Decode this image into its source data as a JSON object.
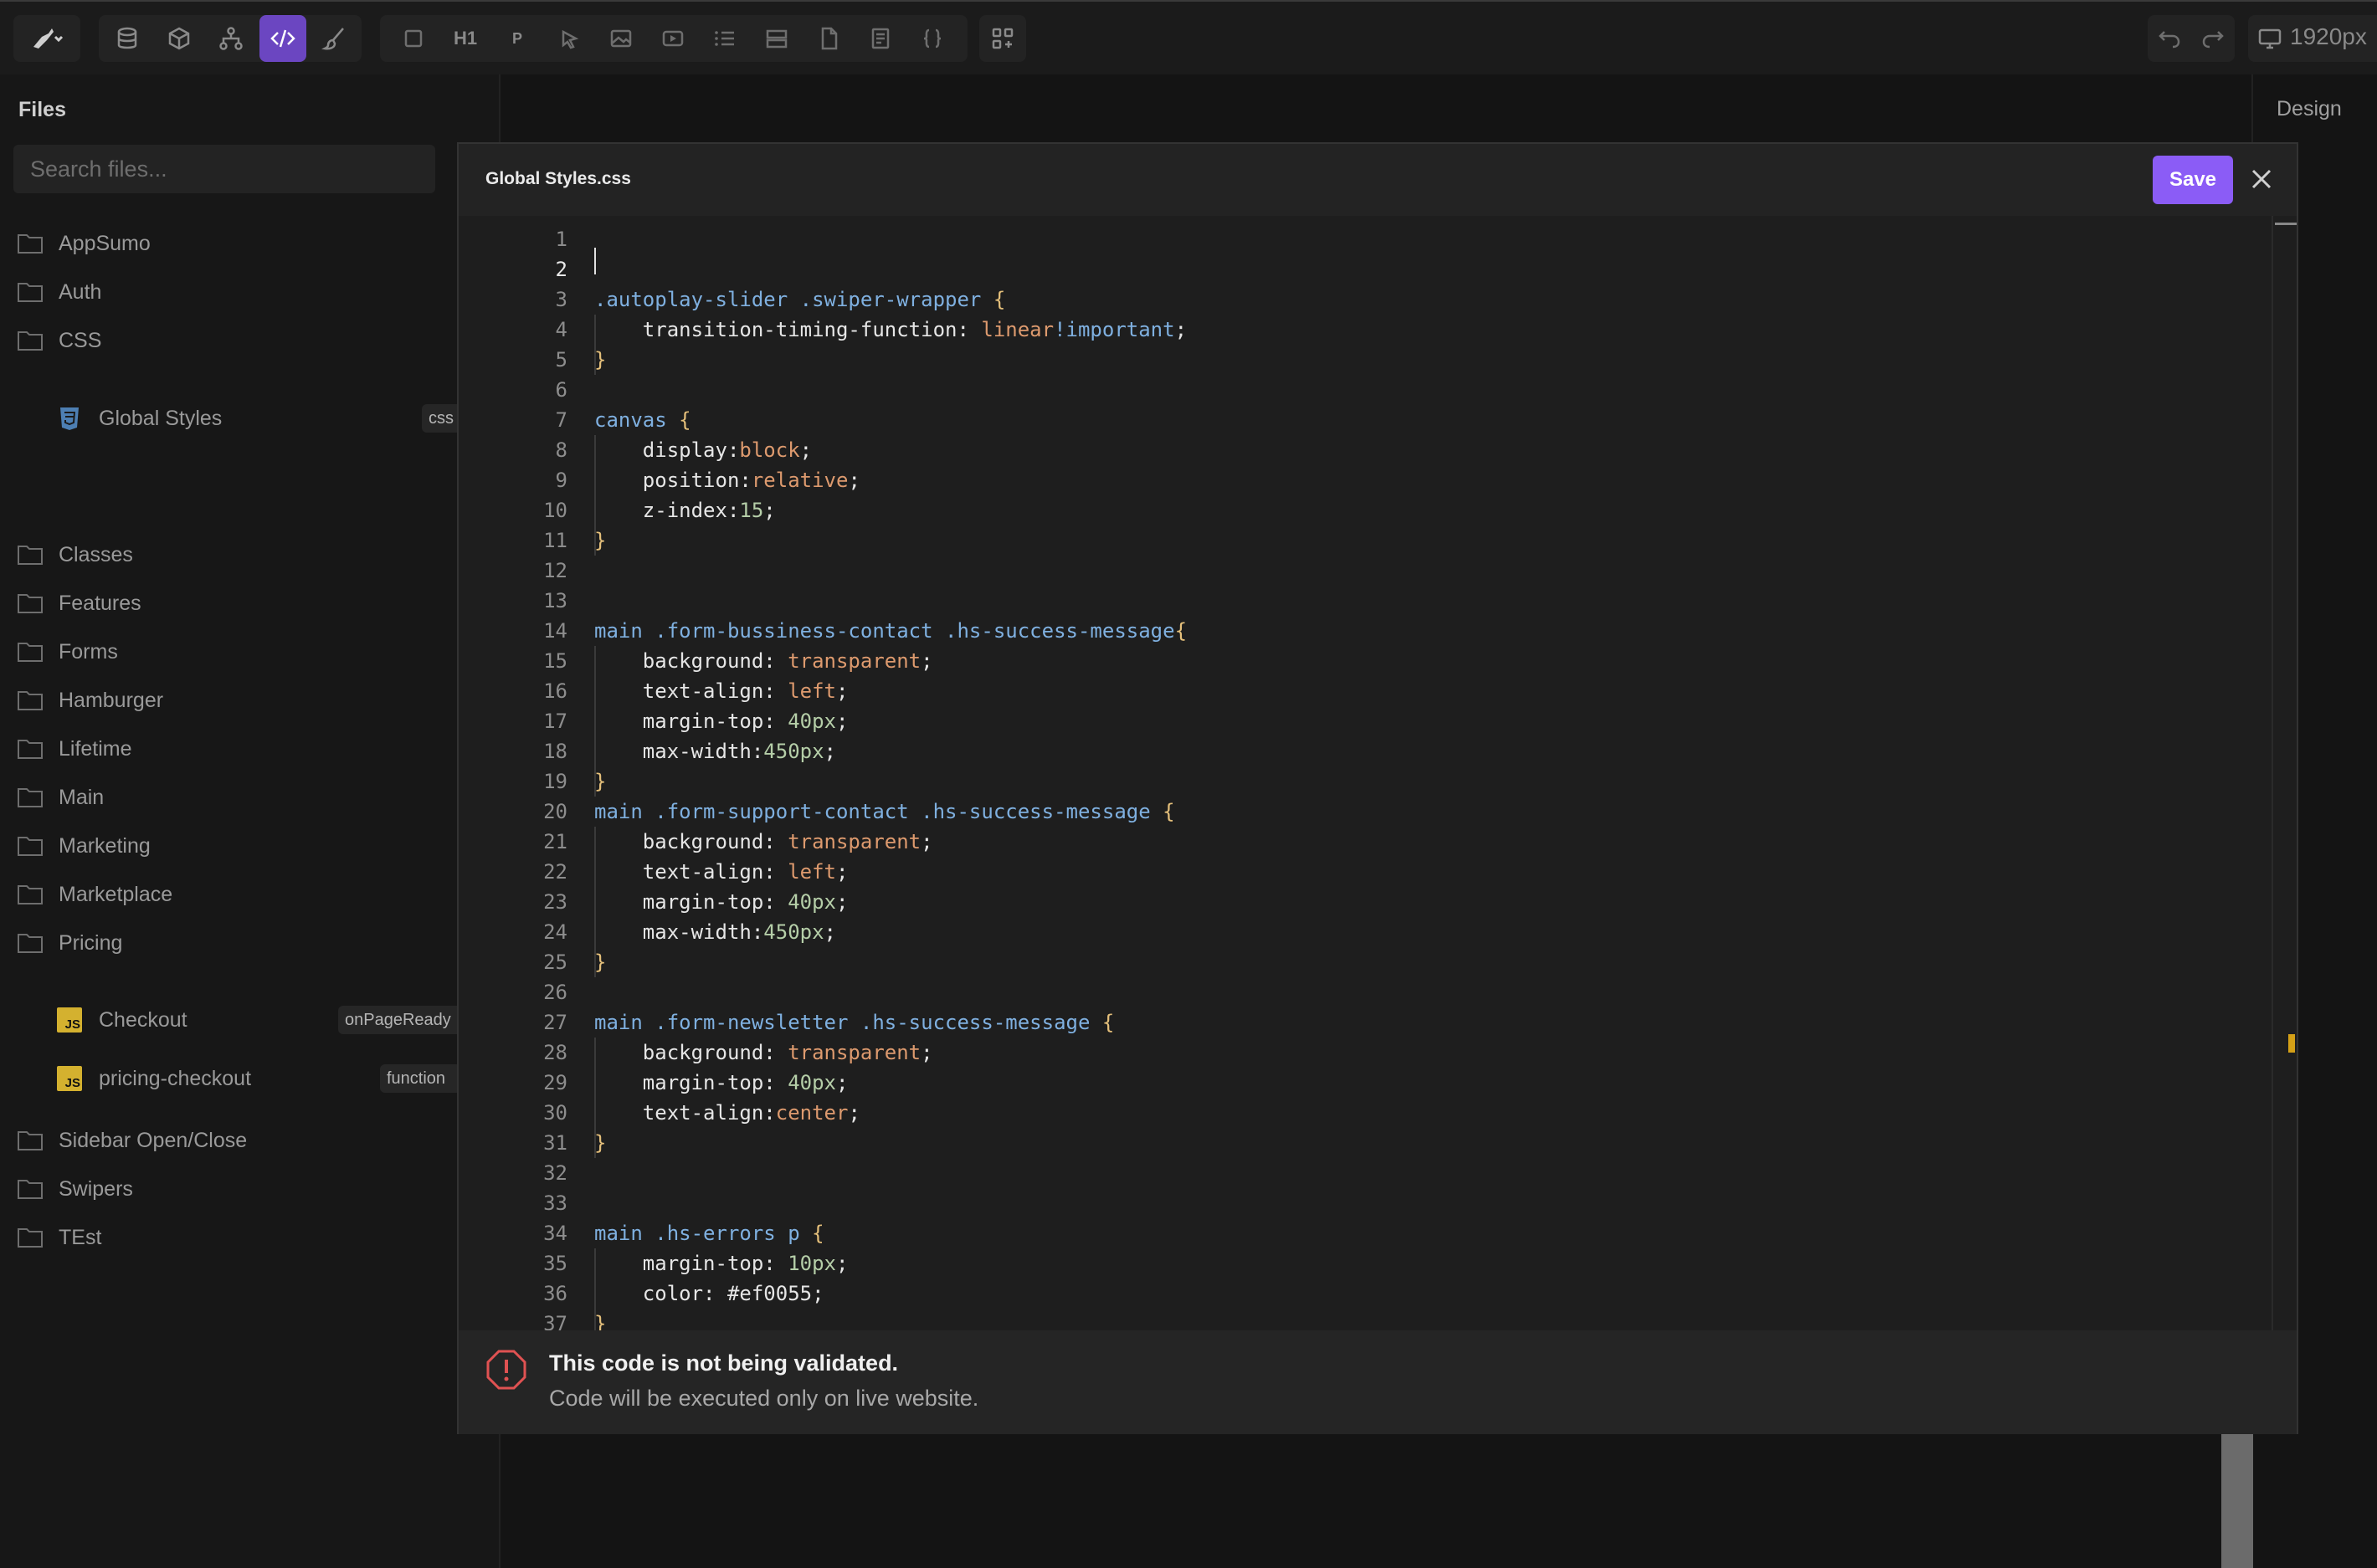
{
  "toolbar": {
    "text_buttons": {
      "heading": "H1",
      "paragraph": "P"
    },
    "width_label": "1920px",
    "accent": "#6b46c1"
  },
  "files": {
    "title": "Files",
    "search_placeholder": "Search files...",
    "folders": {
      "appsumo": "AppSumo",
      "auth": "Auth",
      "css": "CSS",
      "classes": "Classes",
      "features": "Features",
      "forms": "Forms",
      "hamburger": "Hamburger",
      "lifetime": "Lifetime",
      "main": "Main",
      "marketing": "Marketing",
      "marketplace": "Marketplace",
      "pricing": "Pricing",
      "sidebar": "Sidebar Open/Close",
      "swipers": "Swipers",
      "test": "TEst"
    },
    "global_styles": {
      "label": "Global Styles",
      "tag": "css"
    },
    "checkout": {
      "label": "Checkout",
      "tag": "onPageReady",
      "icon": "JS"
    },
    "pricing_checkout": {
      "label": "pricing-checkout",
      "tag": "function",
      "icon": "JS"
    }
  },
  "right_panel": {
    "design_tab": "Design"
  },
  "modal": {
    "title": "Global Styles.css",
    "save_label": "Save",
    "save_color": "#8b5cf6",
    "warning_title": "This code is not being validated.",
    "warning_subtitle": "Code will be executed only on live website.",
    "warning_color": "#e05252",
    "line_numbers": [
      "1",
      "2",
      "3",
      "4",
      "5",
      "6",
      "7",
      "8",
      "9",
      "10",
      "11",
      "12",
      "13",
      "14",
      "15",
      "16",
      "17",
      "18",
      "19",
      "20",
      "21",
      "22",
      "23",
      "24",
      "25",
      "26",
      "27",
      "28",
      "29",
      "30",
      "31",
      "32",
      "33",
      "34",
      "35",
      "36",
      "37"
    ],
    "current_line": "2",
    "code": [
      [],
      [],
      [
        [
          "sel",
          ".autoplay-slider .swiper-wrapper "
        ],
        [
          "brace",
          "{"
        ]
      ],
      [
        [
          "prop",
          "    transition-timing-function: "
        ],
        [
          "val",
          "linear"
        ],
        [
          "kw",
          "!important"
        ],
        [
          "prop",
          ";"
        ]
      ],
      [
        [
          "brace",
          "}"
        ]
      ],
      [],
      [
        [
          "sel",
          "canvas "
        ],
        [
          "brace",
          "{"
        ]
      ],
      [
        [
          "prop",
          "    display:"
        ],
        [
          "val",
          "block"
        ],
        [
          "prop",
          ";"
        ]
      ],
      [
        [
          "prop",
          "    position:"
        ],
        [
          "val",
          "relative"
        ],
        [
          "prop",
          ";"
        ]
      ],
      [
        [
          "prop",
          "    z-index:"
        ],
        [
          "num",
          "15"
        ],
        [
          "prop",
          ";"
        ]
      ],
      [
        [
          "brace",
          "}"
        ]
      ],
      [],
      [],
      [
        [
          "sel",
          "main .form-bussiness-contact .hs-success-message"
        ],
        [
          "brace",
          "{"
        ]
      ],
      [
        [
          "prop",
          "    background: "
        ],
        [
          "val",
          "transparent"
        ],
        [
          "prop",
          ";"
        ]
      ],
      [
        [
          "prop",
          "    text-align: "
        ],
        [
          "val",
          "left"
        ],
        [
          "prop",
          ";"
        ]
      ],
      [
        [
          "prop",
          "    margin-top: "
        ],
        [
          "num",
          "40px"
        ],
        [
          "prop",
          ";"
        ]
      ],
      [
        [
          "prop",
          "    max-width:"
        ],
        [
          "num",
          "450px"
        ],
        [
          "prop",
          ";"
        ]
      ],
      [
        [
          "brace",
          "}"
        ]
      ],
      [
        [
          "sel",
          "main .form-support-contact .hs-success-message "
        ],
        [
          "brace",
          "{"
        ]
      ],
      [
        [
          "prop",
          "    background: "
        ],
        [
          "val",
          "transparent"
        ],
        [
          "prop",
          ";"
        ]
      ],
      [
        [
          "prop",
          "    text-align: "
        ],
        [
          "val",
          "left"
        ],
        [
          "prop",
          ";"
        ]
      ],
      [
        [
          "prop",
          "    margin-top: "
        ],
        [
          "num",
          "40px"
        ],
        [
          "prop",
          ";"
        ]
      ],
      [
        [
          "prop",
          "    max-width:"
        ],
        [
          "num",
          "450px"
        ],
        [
          "prop",
          ";"
        ]
      ],
      [
        [
          "brace",
          "}"
        ]
      ],
      [],
      [
        [
          "sel",
          "main .form-newsletter .hs-success-message "
        ],
        [
          "brace",
          "{"
        ]
      ],
      [
        [
          "prop",
          "    background: "
        ],
        [
          "val",
          "transparent"
        ],
        [
          "prop",
          ";"
        ]
      ],
      [
        [
          "prop",
          "    margin-top: "
        ],
        [
          "num",
          "40px"
        ],
        [
          "prop",
          ";"
        ]
      ],
      [
        [
          "prop",
          "    text-align:"
        ],
        [
          "val",
          "center"
        ],
        [
          "prop",
          ";"
        ]
      ],
      [
        [
          "brace",
          "}"
        ]
      ],
      [],
      [],
      [
        [
          "sel",
          "main .hs-errors p "
        ],
        [
          "brace",
          "{"
        ]
      ],
      [
        [
          "prop",
          "    margin-top: "
        ],
        [
          "num",
          "10px"
        ],
        [
          "prop",
          ";"
        ]
      ],
      [
        [
          "prop",
          "    color: #ef0055;"
        ]
      ],
      [
        [
          "brace",
          "}"
        ]
      ]
    ]
  }
}
